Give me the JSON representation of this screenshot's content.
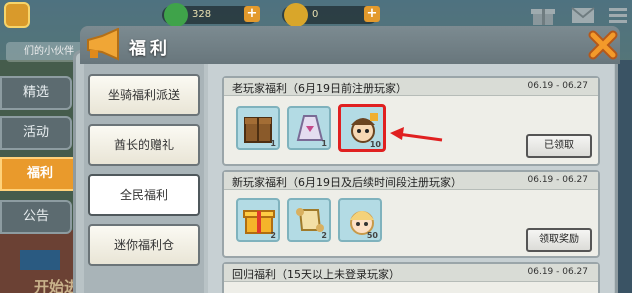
{
  "top_bar": {
    "resources": [
      {
        "icon": "green-gem-icon",
        "value": "328",
        "color": "#3fa34a"
      },
      {
        "icon": "gold-coin-icon",
        "value": "0",
        "color": "#d9a62a"
      }
    ],
    "right_icons": [
      "gift-icon",
      "mail-icon",
      "menu-icon"
    ]
  },
  "background": {
    "friends_tab_fragment": "们的小伙伴",
    "bottom_fragment": "开始进"
  },
  "side_tabs": [
    {
      "label": "精选",
      "active": false
    },
    {
      "label": "活动",
      "active": false
    },
    {
      "label": "福利",
      "active": true
    },
    {
      "label": "公告",
      "active": false
    }
  ],
  "dialog": {
    "title": "福利",
    "close_icon": "close-icon",
    "menu": [
      {
        "label": "坐骑福利派送",
        "active": false
      },
      {
        "label": "酋长的赠礼",
        "active": false
      },
      {
        "label": "全民福利",
        "active": true
      },
      {
        "label": "迷你福利仓",
        "active": false
      }
    ],
    "cards": [
      {
        "title": "老玩家福利（6月19日前注册玩家）",
        "date": "06.19 - 06.27",
        "button": "已领取",
        "items": [
          {
            "icon": "wooden-crate-icon",
            "count": "1",
            "highlight": false
          },
          {
            "icon": "dress-icon",
            "count": "1",
            "highlight": false
          },
          {
            "icon": "avatar-character-icon",
            "count": "10",
            "highlight": true
          }
        ]
      },
      {
        "title": "新玩家福利（6月19日及后续时间段注册玩家）",
        "date": "06.19 - 06.27",
        "button": "领取奖励",
        "items": [
          {
            "icon": "gift-box-icon",
            "count": "2",
            "highlight": false
          },
          {
            "icon": "scroll-icon",
            "count": "2",
            "highlight": false
          },
          {
            "icon": "blonde-character-icon",
            "count": "50",
            "highlight": false
          }
        ]
      },
      {
        "title": "回归福利（15天以上未登录玩家）",
        "date": "06.19 - 06.27",
        "button": "",
        "items": []
      }
    ]
  },
  "colors": {
    "accent_orange": "#e99a2c",
    "highlight_red": "#e02020"
  }
}
